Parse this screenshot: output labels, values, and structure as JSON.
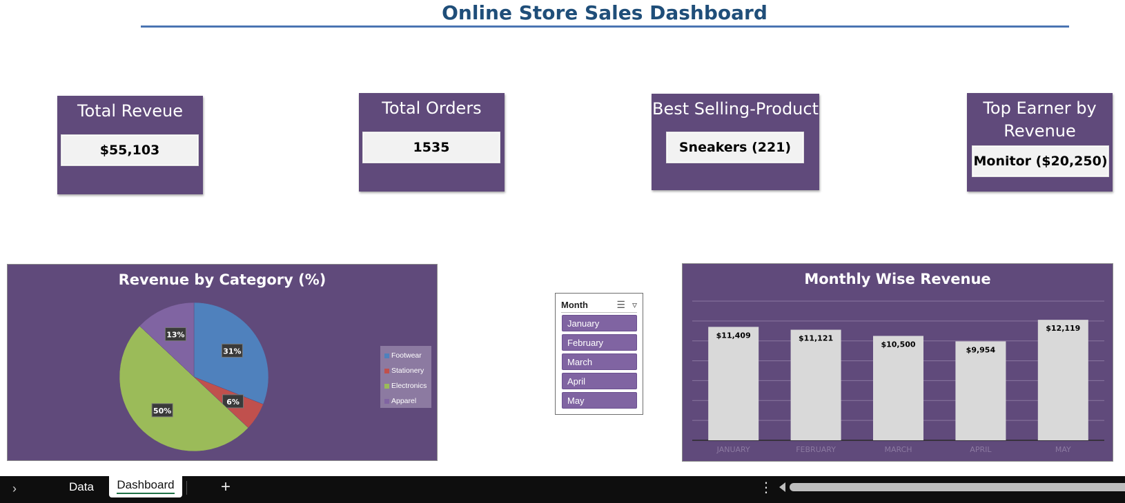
{
  "dashboard": {
    "title": "Online Store Sales Dashboard"
  },
  "kpis": [
    {
      "label": "Total Reveue",
      "value": "$55,103"
    },
    {
      "label": "Total Orders",
      "value": "1535"
    },
    {
      "label": "Best Selling-Product",
      "value": "Sneakers (221)"
    },
    {
      "label": "Top Earner by Revenue",
      "value": "Monitor ($20,250)"
    }
  ],
  "colors": {
    "panel": "#604a7b",
    "title": "#1f4e79",
    "footwear": "#4f81bd",
    "stationery": "#c0504d",
    "electronics": "#9bbb59",
    "apparel": "#8064a2",
    "bar": "#d9d9d9"
  },
  "slicer": {
    "title": "Month",
    "multi_select_icon": "multi-select-icon",
    "clear_filter_icon": "clear-filter-icon",
    "items": [
      "January",
      "February",
      "March",
      "April",
      "May"
    ]
  },
  "chart_data": [
    {
      "type": "pie",
      "title": "Revenue by Category (%)",
      "categories": [
        "Footwear",
        "Stationery",
        "Electronics",
        "Apparel"
      ],
      "values": [
        31,
        6,
        50,
        13
      ],
      "labels": [
        "31%",
        "6%",
        "50%",
        "13%"
      ],
      "legend": "right"
    },
    {
      "type": "bar",
      "title": "Monthly Wise Revenue",
      "categories": [
        "JANUARY",
        "FEBRUARY",
        "MARCH",
        "APRIL",
        "MAY"
      ],
      "values": [
        11409,
        11121,
        10500,
        9954,
        12119
      ],
      "labels": [
        "$11,409",
        "$11,121",
        "$10,500",
        "$9,954",
        "$12,119"
      ],
      "ylim": [
        0,
        14000
      ],
      "grid": true
    }
  ],
  "sheet_tabs": {
    "expand_icon": "chevron-right-icon",
    "tabs": [
      "Data",
      "Dashboard"
    ],
    "active": "Dashboard",
    "add_icon": "plus-icon",
    "more_icon": "more-vertical-icon"
  }
}
